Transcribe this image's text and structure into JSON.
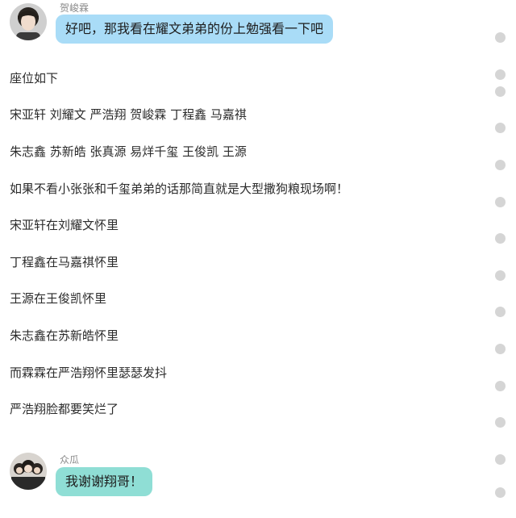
{
  "chat": {
    "first_message": {
      "sender": "贺峻霖",
      "text": "好吧，那我看在耀文弟弟的份上勉强看一下吧",
      "bubble_color": "#a9dcf7"
    },
    "story_lines": [
      "座位如下",
      "宋亚轩 刘耀文 严浩翔 贺峻霖 丁程鑫 马嘉祺",
      "朱志鑫 苏新皓 张真源 易烊千玺 王俊凯 王源",
      "如果不看小张张和千玺弟弟的话那简直就是大型撒狗粮现场啊！",
      "宋亚轩在刘耀文怀里",
      "丁程鑫在马嘉祺怀里",
      "王源在王俊凯怀里",
      "朱志鑫在苏新皓怀里",
      "而霖霖在严浩翔怀里瑟瑟发抖",
      "严浩翔脸都要笑烂了"
    ],
    "last_message": {
      "sender": "众瓜",
      "text": "我谢谢翔哥！",
      "bubble_color": "#8fded5"
    }
  },
  "scrollbar": {
    "dot_color": "#d5d5d5"
  }
}
